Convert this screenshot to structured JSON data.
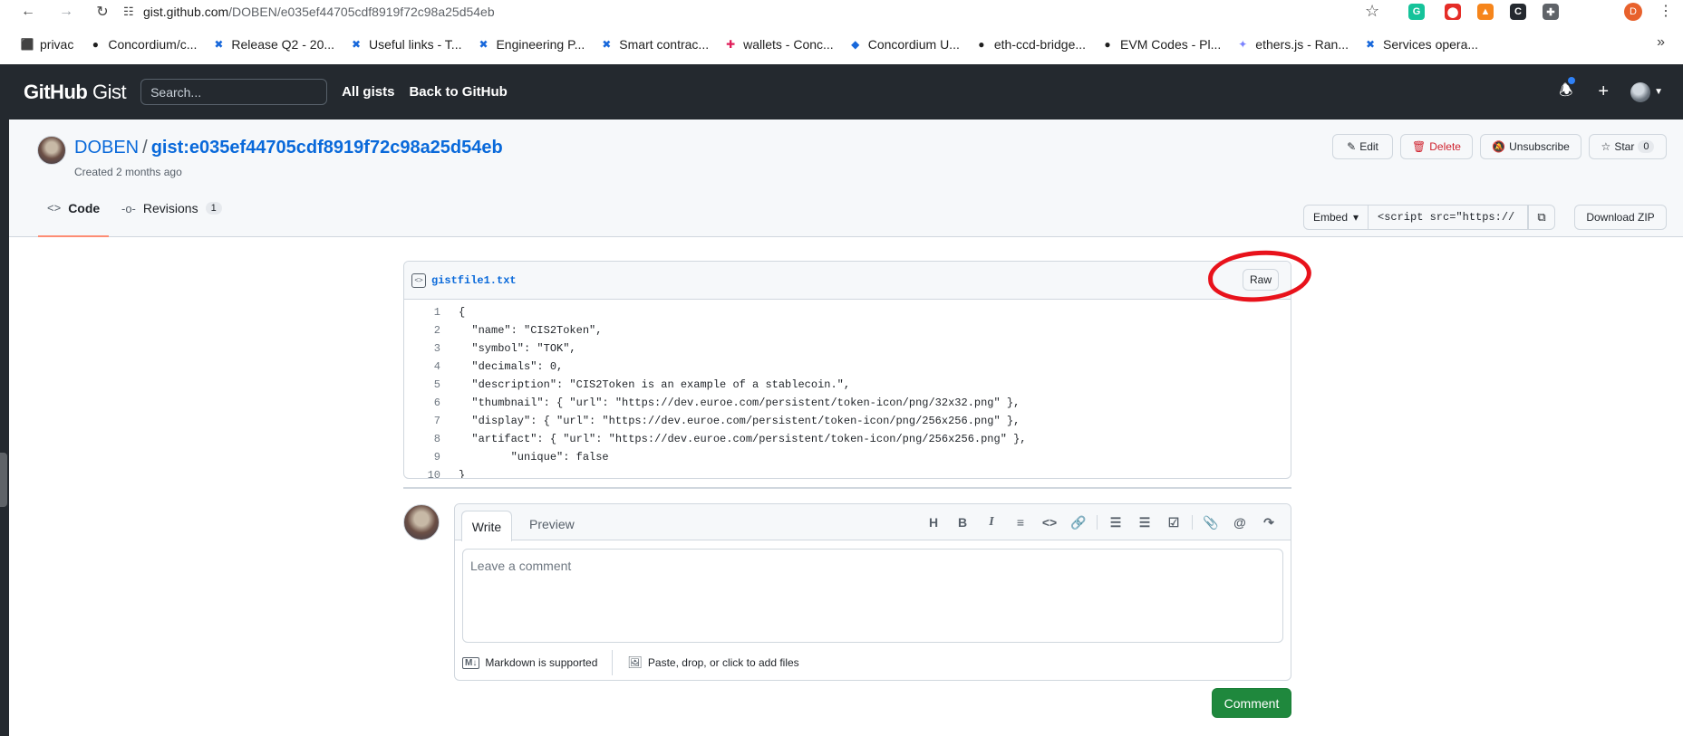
{
  "browser": {
    "url_host": "gist.github.com",
    "url_path": "/DOBEN/e035ef44705cdf8919f72c98a25d54eb",
    "extensions": [
      {
        "name": "grammarly-icon",
        "color": "#15c39a",
        "glyph": "G"
      },
      {
        "name": "shield-ext-icon",
        "color": "#e52d27",
        "glyph": "⬤"
      },
      {
        "name": "metamask-icon",
        "color": "#f6851b",
        "glyph": "▲"
      },
      {
        "name": "concordium-ext-icon",
        "color": "#24292f",
        "glyph": "C"
      },
      {
        "name": "puzzle-icon",
        "color": "#5f6368",
        "glyph": "✚"
      }
    ],
    "profile_initial": "D",
    "bookmarks": [
      {
        "label": "privac",
        "icon": "privacy-icon",
        "color": "#1f1f1f",
        "glyph": "⬛"
      },
      {
        "label": "Concordium/c...",
        "icon": "github-icon",
        "color": "#1f1f1f",
        "glyph": "●"
      },
      {
        "label": "Release Q2 - 20...",
        "icon": "confluence-icon",
        "color": "#1868db",
        "glyph": "✖"
      },
      {
        "label": "Useful links - T...",
        "icon": "confluence-icon",
        "color": "#1868db",
        "glyph": "✖"
      },
      {
        "label": "Engineering P...",
        "icon": "confluence-icon",
        "color": "#1868db",
        "glyph": "✖"
      },
      {
        "label": "Smart contrac...",
        "icon": "confluence-icon",
        "color": "#1868db",
        "glyph": "✖"
      },
      {
        "label": "wallets - Conc...",
        "icon": "slack-icon",
        "color": "#e01e5a",
        "glyph": "✚"
      },
      {
        "label": "Concordium U...",
        "icon": "concordium-icon",
        "color": "#1868db",
        "glyph": "◆"
      },
      {
        "label": "eth-ccd-bridge...",
        "icon": "github-icon",
        "color": "#1f1f1f",
        "glyph": "●"
      },
      {
        "label": "EVM Codes - Pl...",
        "icon": "evm-icon",
        "color": "#1f1f1f",
        "glyph": "●"
      },
      {
        "label": "ethers.js - Ran...",
        "icon": "ethers-icon",
        "color": "#7b83ff",
        "glyph": "✦"
      },
      {
        "label": "Services opera...",
        "icon": "confluence-icon",
        "color": "#1868db",
        "glyph": "✖"
      }
    ]
  },
  "header": {
    "logo_main": "GitHub",
    "logo_sub": "Gist",
    "search_placeholder": "Search...",
    "all_gists": "All gists",
    "back_to_github": "Back to GitHub"
  },
  "gist": {
    "owner": "DOBEN",
    "separator": "/",
    "name": "gist:e035ef44705cdf8919f72c98a25d54eb",
    "created": "Created 2 months ago",
    "edit": "Edit",
    "delete": "Delete",
    "unsubscribe": "Unsubscribe",
    "star": "Star",
    "star_count": "0",
    "tab_code": "Code",
    "tab_revisions": "Revisions",
    "revisions_count": "1",
    "embed_label": "Embed",
    "embed_value": "<script src=\"https://",
    "download_zip": "Download ZIP"
  },
  "file": {
    "name": "gistfile1.txt",
    "raw": "Raw",
    "lines": [
      {
        "n": "1",
        "text": "{"
      },
      {
        "n": "2",
        "text": "  \"name\": \"CIS2Token\","
      },
      {
        "n": "3",
        "text": "  \"symbol\": \"TOK\","
      },
      {
        "n": "4",
        "text": "  \"decimals\": 0,"
      },
      {
        "n": "5",
        "text": "  \"description\": \"CIS2Token is an example of a stablecoin.\","
      },
      {
        "n": "6",
        "text": "  \"thumbnail\": { \"url\": \"https://dev.euroe.com/persistent/token-icon/png/32x32.png\" },"
      },
      {
        "n": "7",
        "text": "  \"display\": { \"url\": \"https://dev.euroe.com/persistent/token-icon/png/256x256.png\" },"
      },
      {
        "n": "8",
        "text": "  \"artifact\": { \"url\": \"https://dev.euroe.com/persistent/token-icon/png/256x256.png\" },"
      },
      {
        "n": "9",
        "text": "        \"unique\": false"
      },
      {
        "n": "10",
        "text": "}"
      }
    ]
  },
  "comment": {
    "tab_write": "Write",
    "tab_preview": "Preview",
    "placeholder": "Leave a comment",
    "markdown_note": "Markdown is supported",
    "attach_note": "Paste, drop, or click to add files",
    "submit": "Comment"
  }
}
